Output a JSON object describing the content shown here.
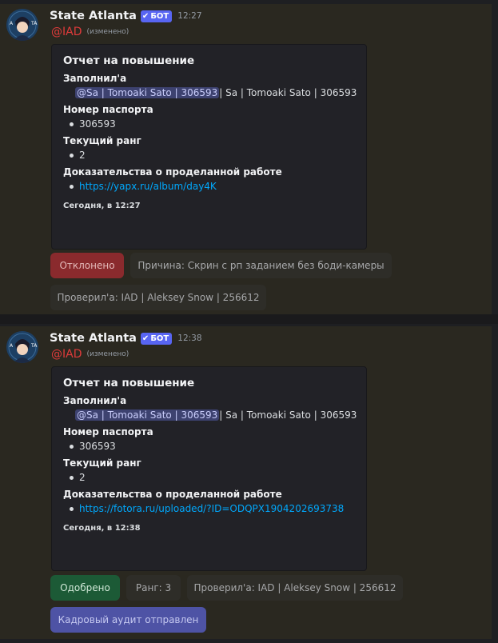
{
  "messages": [
    {
      "author": "State Atlanta",
      "bot_tag": "БОТ",
      "time": "12:27",
      "role_mention": "@IAD",
      "edited": "(изменено)",
      "embed": {
        "title": "Отчет на повышение",
        "fields": [
          {
            "name": "Заполнил'а",
            "mention": "@Sa | Tomoaki Sato | 306593",
            "value": " | Sa | Tomoaki Sato | 306593"
          },
          {
            "name": "Номер паспорта",
            "value": "306593"
          },
          {
            "name": "Текущий ранг",
            "value": "2"
          },
          {
            "name": "Доказательства о проделанной работе",
            "link": "https://yapx.ru/album/day4K"
          }
        ],
        "footer": "Сегодня, в 12:27"
      },
      "buttons": [
        {
          "label": "Отклонено",
          "style": "danger"
        },
        {
          "label": "Причина: Скрин с рп заданием без боди-камеры",
          "style": "secondary"
        },
        {
          "label": "Проверил'а: IAD | Aleksey Snow | 256612",
          "style": "secondary"
        }
      ]
    },
    {
      "author": "State Atlanta",
      "bot_tag": "БОТ",
      "time": "12:38",
      "role_mention": "@IAD",
      "edited": "(изменено)",
      "embed": {
        "title": "Отчет на повышение",
        "fields": [
          {
            "name": "Заполнил'а",
            "mention": "@Sa | Tomoaki Sato | 306593",
            "value": " | Sa | Tomoaki Sato | 306593"
          },
          {
            "name": "Номер паспорта",
            "value": "306593"
          },
          {
            "name": "Текущий ранг",
            "value": "2"
          },
          {
            "name": "Доказательства о проделанной работе",
            "link": "https://fotora.ru/uploaded/?ID=ODQPX1904202693738"
          }
        ],
        "footer": "Сегодня, в 12:38"
      },
      "buttons": [
        {
          "label": "Одобрено",
          "style": "success"
        },
        {
          "label": "Ранг: 3",
          "style": "secondary"
        },
        {
          "label": "Проверил'а: IAD | Aleksey Snow | 256612",
          "style": "secondary"
        },
        {
          "label": "Кадровый аудит отправлен",
          "style": "primary"
        }
      ]
    }
  ],
  "colors": {
    "background": "#1e1f22",
    "message_bg": "#2a2820",
    "embed_bg": "#222227",
    "bot_tag": "#5865f2",
    "role_mention": "#e03b3b",
    "link": "#00a8fc",
    "danger": "#8a2a2d",
    "success": "#1c5a36",
    "primary": "#4e53a5"
  },
  "icons": [
    "bot-avatar-icon",
    "verified-check-icon"
  ]
}
